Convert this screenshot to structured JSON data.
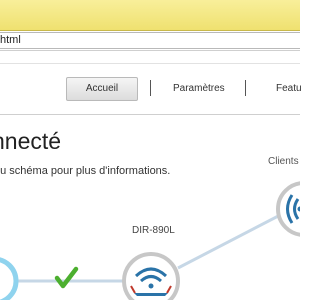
{
  "browser": {
    "address_text": "html"
  },
  "nav": {
    "tabs": [
      {
        "label": "Accueil",
        "active": true
      },
      {
        "label": "Paramètres",
        "active": false
      },
      {
        "label": "Featu",
        "active": false
      }
    ]
  },
  "main": {
    "heading": "nnecté",
    "subtitle": "du schéma pour plus d'informations.",
    "clients_label": "Clients",
    "router_label": "DIR-890L"
  },
  "colors": {
    "accent": "#2a73a8",
    "check": "#4caf2f",
    "titlebar": "#f3e680",
    "node_border": "#bfbfbf",
    "link_line": "#c6d7e6"
  },
  "icons": {
    "internet_node": "globe-icon",
    "router_node": "router-icon",
    "clients_node": "wifi-icon",
    "status": "checkmark-icon"
  }
}
